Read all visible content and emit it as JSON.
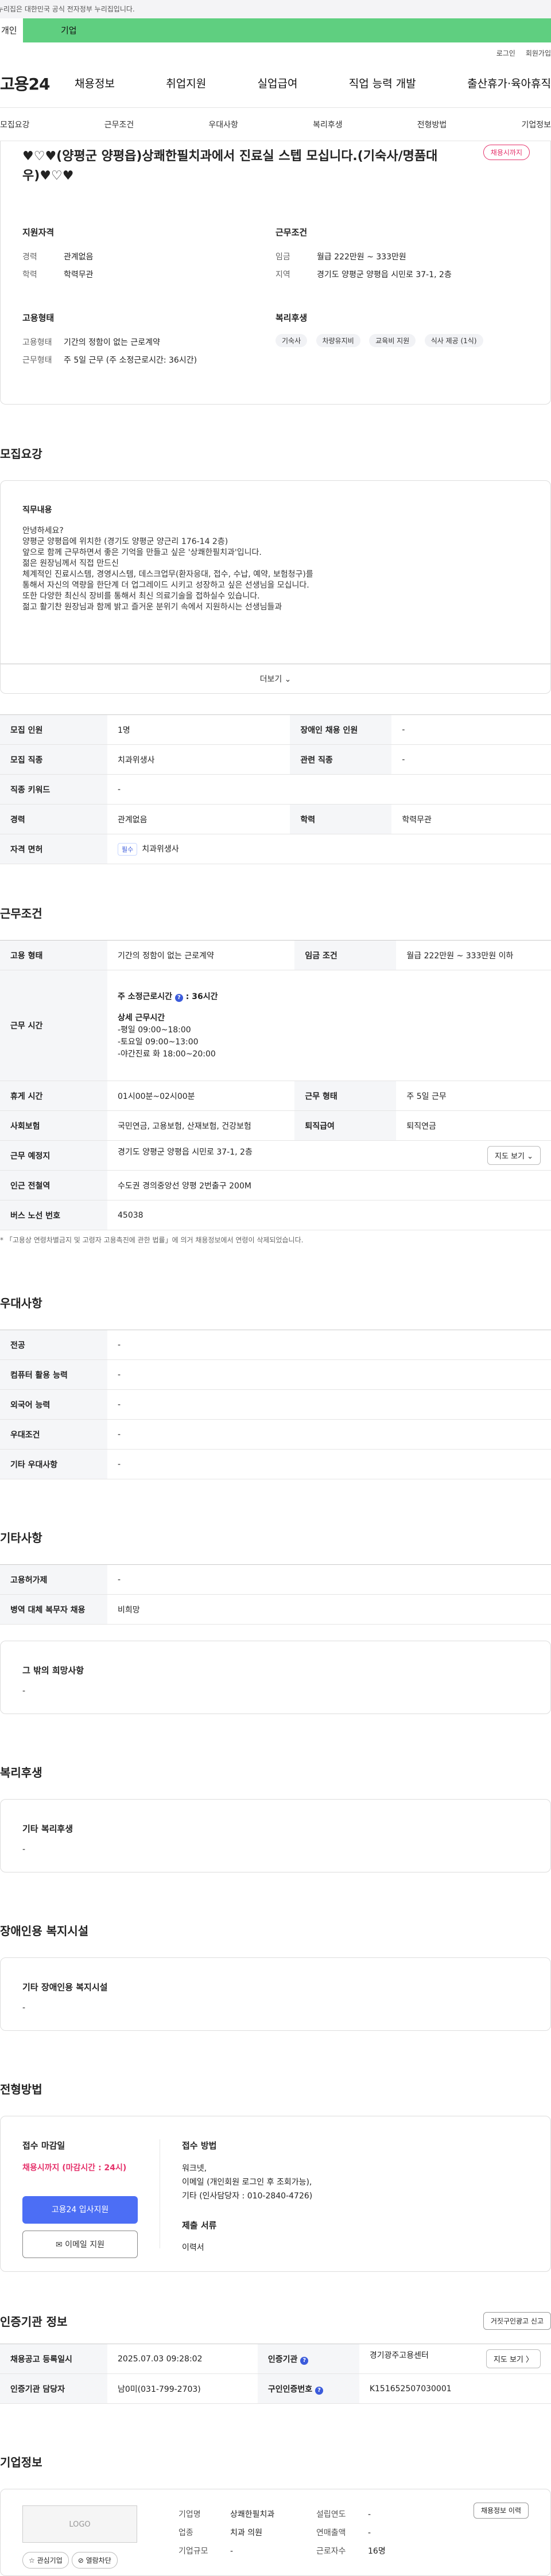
{
  "gov_bar": "이 누리집은 대한민국 공식 전자정부 누리집입니다.",
  "tabs": {
    "person": "개인",
    "company": "기업"
  },
  "util": {
    "login": "로그인",
    "signup": "회원가입"
  },
  "logo": "고용24",
  "gnb": [
    "채용정보",
    "취업지원",
    "실업급여",
    "직업 능력 개발",
    "출산휴가·육아휴직"
  ],
  "anchors": [
    "모집요강",
    "근무조건",
    "우대사항",
    "복리후생",
    "전형방법",
    "기업정보"
  ],
  "job": {
    "title": "♥♡♥(양평군 양평읍)상쾌한필치과에서 진료실 스텝 모십니다.(기숙사/명품대우)♥♡♥",
    "badge": "채용시까지",
    "qual_h": "지원자격",
    "qual": [
      {
        "k": "경력",
        "v": "관계없음"
      },
      {
        "k": "학력",
        "v": "학력무관"
      }
    ],
    "cond_h": "근무조건",
    "cond": [
      {
        "k": "임금",
        "v": "월급 222만원 ~ 333만원"
      },
      {
        "k": "지역",
        "v": "경기도 양평군 양평읍 시민로 37-1, 2층"
      }
    ],
    "emp_h": "고용형태",
    "emp": [
      {
        "k": "고용형태",
        "v": "기간의 정함이 없는 근로계약"
      },
      {
        "k": "근무형태",
        "v": "주 5일 근무 (주 소정근로시간: 36시간)"
      }
    ],
    "welfare_h": "복리후생",
    "welfare_tags": [
      "기숙사",
      "차량유지비",
      "교육비 지원",
      "식사 제공 (1식)"
    ]
  },
  "recruit": {
    "title": "모집요강",
    "desc_h": "직무내용",
    "desc": [
      "안녕하세요?",
      "양평군 양평읍에 위치한 (경기도 양평군 양근리 176-14 2층)",
      "앞으로 함께 근무하면서 좋은 기억을 만들고 싶은 '상쾌한필치과'입니다.",
      "",
      "젊은 원장님께서 직접 만드신",
      "체계적인 진료시스템, 경영시스템, 데스크업무(환자응대, 접수, 수납, 예약, 보험청구)를",
      "통해서 자신의 역량을 한단계 더 업그레이드 시키고 성장하고 싶은 선생님을 모십니다.",
      "또한 다양한 최신식 장비를 통해서 최신 의료기술을 접하실수 있습니다.",
      "젊고 활기찬 원장님과 함께 밝고 즐거운 분위기 속에서 지원하시는 선생님들과"
    ],
    "more": "더보기 ⌄",
    "rows": [
      [
        {
          "h": "모집 인원"
        },
        {
          "v": "1명"
        },
        {
          "h": "장애인 채용 인원"
        },
        {
          "v": "-"
        }
      ],
      [
        {
          "h": "모집 직종"
        },
        {
          "v": "치과위생사"
        },
        {
          "h": "관련 직종"
        },
        {
          "v": "-"
        }
      ],
      [
        {
          "h": "직종 키워드"
        },
        {
          "v": "-"
        }
      ],
      [
        {
          "h": "경력"
        },
        {
          "v": "관계없음"
        },
        {
          "h": "학력"
        },
        {
          "v": "학력무관"
        }
      ],
      [
        {
          "h": "자격 면허"
        },
        {
          "tag": "필수",
          "v": "치과위생사"
        }
      ]
    ]
  },
  "work": {
    "title": "근무조건",
    "emp_type_h": "고용 형태",
    "emp_type": "기간의 정함이 없는 근로계약",
    "wage_h": "임금 조건",
    "wage": "월급 222만원 ~ 333만원 이하",
    "hours_h": "근무 시간",
    "hours_weekly": "주 소정근로시간",
    "hours_weekly_v": "36시간",
    "hours_detail_h": "상세 근무시간",
    "hours_detail": [
      "-평일 09:00~18:00",
      "-토요일 09:00~13:00",
      "-야간진료 화 18:00~20:00"
    ],
    "break_h": "휴게 시간",
    "break": "01시00분~02시00분",
    "form_h": "근무 형태",
    "form": "주 5일 근무",
    "ins_h": "사회보험",
    "ins": "국민연금, 고용보험, 산재보험, 건강보험",
    "ret_h": "퇴직급여",
    "ret": "퇴직연금",
    "place_h": "근무 예정지",
    "place": "경기도 양평군 양평읍 시민로 37-1, 2층",
    "map_btn": "지도 보기 ⌄",
    "subway_h": "인근 전철역",
    "subway": "수도권 경의중앙선 양평 2번출구 200M",
    "bus_h": "버스 노선 번호",
    "bus": "45038",
    "footnote": "* 「고용상 연령차별금지 및 고령자 고용촉진에 관한 법률」에 의거 채용정보에서 연령이 삭제되었습니다."
  },
  "pref": {
    "title": "우대사항",
    "rows": [
      {
        "h": "전공",
        "v": "-"
      },
      {
        "h": "컴퓨터 활용 능력",
        "v": "-"
      },
      {
        "h": "외국어 능력",
        "v": "-"
      },
      {
        "h": "우대조건",
        "v": "-"
      },
      {
        "h": "기타 우대사항",
        "v": "-"
      }
    ]
  },
  "etc": {
    "title": "기타사항",
    "rows": [
      {
        "h": "고용허가제",
        "v": "-"
      },
      {
        "h": "병역 대체 복무자 채용",
        "v": "비희망"
      }
    ],
    "wish_h": "그 밖의 희망사항",
    "wish_v": "-"
  },
  "welfare": {
    "title": "복리후생",
    "h": "기타 복리후생",
    "v": "-"
  },
  "disabled": {
    "title": "장애인용 복지시설",
    "h": "기타 장애인용 복지시설",
    "v": "-"
  },
  "screening": {
    "title": "전형방법",
    "deadline_h": "접수 마감일",
    "deadline": "채용시까지 (마감시간 : 24시)",
    "apply_btn": "고용24 입사지원",
    "email_btn": "✉ 이메일 지원",
    "method_h": "접수 방법",
    "method": [
      "워크넷,",
      "이메일 (개인회원 로그인 후 조회가능),",
      "기타 (인사담당자 : 010-2840-4726)"
    ],
    "docs_h": "제출 서류",
    "docs": "이력서"
  },
  "cert": {
    "title": "인증기관 정보",
    "report_btn": "거짓구인광고 신고",
    "reg_h": "채용공고 등록일시",
    "reg": "2025.07.03 09:28:02",
    "org_h": "인증기관",
    "org": "경기광주고용센터",
    "map_btn": "지도 보기 〉",
    "mgr_h": "인증기관 담당자",
    "mgr": "남0미(031-799-2703)",
    "no_h": "구인인증번호",
    "no": "K151652507030001"
  },
  "company": {
    "title": "기업정보",
    "logo": "LOGO",
    "fav_btn": "☆ 관심기업",
    "block_btn": "⊘ 열람차단",
    "name_h": "기업명",
    "name": "상쾌한필치과",
    "est_h": "설립연도",
    "est": "-",
    "ind_h": "업종",
    "ind": "치과 의원",
    "sales_h": "연매출액",
    "sales": "-",
    "size_h": "기업규모",
    "size": "-",
    "emp_h": "근로자수",
    "emp": "16명",
    "history_btn": "채용정보 이력"
  }
}
